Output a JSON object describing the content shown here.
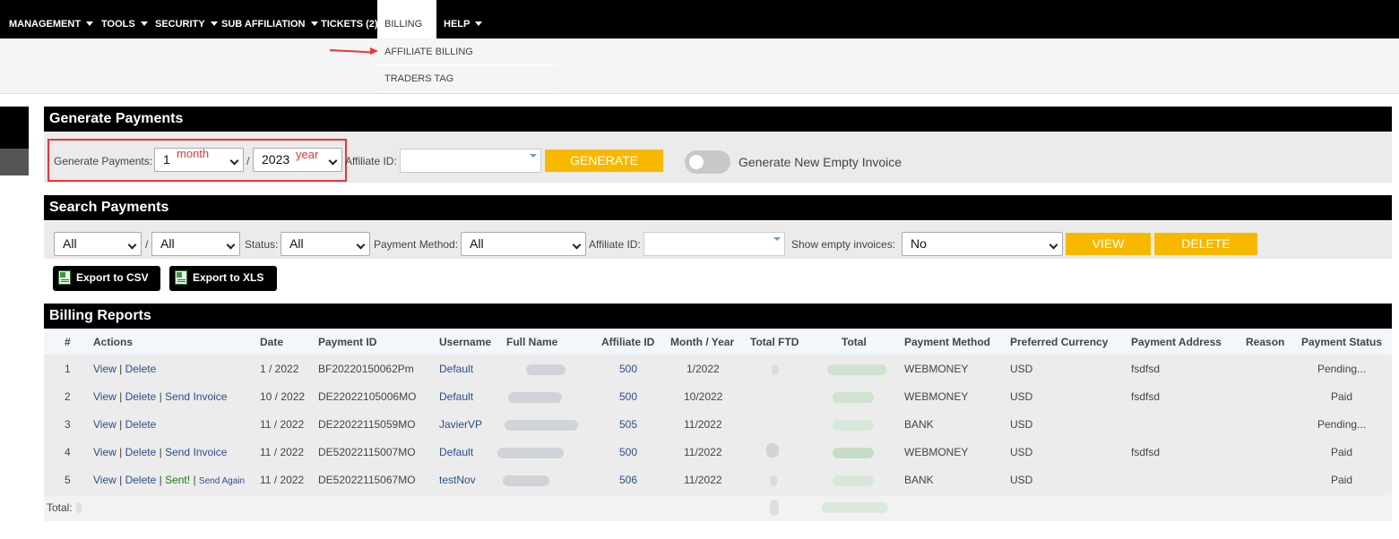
{
  "nav": {
    "items": [
      {
        "label": "MANAGEMENT",
        "caret": true
      },
      {
        "label": "TOOLS",
        "caret": true
      },
      {
        "label": "SECURITY",
        "caret": true
      },
      {
        "label": "SUB AFFILIATION",
        "caret": true
      },
      {
        "label": "TICKETS (2)",
        "caret": false
      },
      {
        "label": "BILLING",
        "caret": false,
        "active": true
      },
      {
        "label": "HELP",
        "caret": true
      }
    ],
    "billing_submenu": [
      "AFFILIATE BILLING",
      "TRADERS TAG"
    ]
  },
  "generate": {
    "title": "Generate Payments",
    "label": "Generate Payments:",
    "month_value": "1",
    "separator": "/",
    "year_value": "2023",
    "month_note": "month",
    "year_note": "year",
    "affiliate_label": "Affiliate ID:",
    "affiliate_value": "",
    "generate_button": "GENERATE",
    "toggle_label": "Generate New Empty Invoice",
    "toggle_on": false
  },
  "search": {
    "title": "Search Payments",
    "month_value": "All",
    "separator": "/",
    "year_value": "All",
    "status_label": "Status:",
    "status_value": "All",
    "method_label": "Payment Method:",
    "method_value": "All",
    "affiliate_label": "Affiliate ID:",
    "affiliate_value": "",
    "empty_label": "Show empty invoices:",
    "empty_value": "No",
    "view_button": "VIEW",
    "delete_button": "DELETE",
    "export_csv": "Export to CSV",
    "export_xls": "Export to XLS"
  },
  "reports": {
    "title": "Billing Reports",
    "columns": [
      "#",
      "Actions",
      "Date",
      "Payment ID",
      "Username",
      "Full Name",
      "Affiliate ID",
      "Month / Year",
      "Total FTD",
      "Total",
      "Payment Method",
      "Preferred Currency",
      "Payment Address",
      "Reason",
      "Payment Status"
    ],
    "rows": [
      {
        "num": "1",
        "view": "View",
        "delete": "Delete",
        "send": "",
        "sent": "",
        "send_again": "",
        "date": "1 / 2022",
        "payment_id": "BF20220150062Pm",
        "username": "Default",
        "affiliate_id": "500",
        "month_year": "1/2022",
        "method": "WEBMONEY",
        "currency": "USD",
        "address": "fsdfsd",
        "reason": "",
        "status": "Pending..."
      },
      {
        "num": "2",
        "view": "View",
        "delete": "Delete",
        "send": "Send Invoice",
        "sent": "",
        "send_again": "",
        "date": "10 / 2022",
        "payment_id": "DE22022105006MO",
        "username": "Default",
        "affiliate_id": "500",
        "month_year": "10/2022",
        "method": "WEBMONEY",
        "currency": "USD",
        "address": "fsdfsd",
        "reason": "",
        "status": "Paid"
      },
      {
        "num": "3",
        "view": "View",
        "delete": "Delete",
        "send": "",
        "sent": "",
        "send_again": "",
        "date": "11 / 2022",
        "payment_id": "DE22022115059MO",
        "username": "JavierVP",
        "affiliate_id": "505",
        "month_year": "11/2022",
        "method": "BANK",
        "currency": "USD",
        "address": "",
        "reason": "",
        "status": "Pending..."
      },
      {
        "num": "4",
        "view": "View",
        "delete": "Delete",
        "send": "Send Invoice",
        "sent": "",
        "send_again": "",
        "date": "11 / 2022",
        "payment_id": "DE52022115007MO",
        "username": "Default",
        "affiliate_id": "500",
        "month_year": "11/2022",
        "method": "WEBMONEY",
        "currency": "USD",
        "address": "fsdfsd",
        "reason": "",
        "status": "Paid"
      },
      {
        "num": "5",
        "view": "View",
        "delete": "Delete",
        "send": "",
        "sent": "Sent!",
        "send_again": "Send Again",
        "date": "11 / 2022",
        "payment_id": "DE52022115067MO",
        "username": "testNov",
        "affiliate_id": "506",
        "month_year": "11/2022",
        "method": "BANK",
        "currency": "USD",
        "address": "",
        "reason": "",
        "status": "Paid"
      }
    ],
    "footer_total_label": "Total:"
  },
  "colors": {
    "nav_bg": "#000000",
    "accent_yellow": "#f9b800",
    "link_blue": "#2a4f8a",
    "annotation_red": "#e33333",
    "sent_green": "#1a7a1a"
  }
}
